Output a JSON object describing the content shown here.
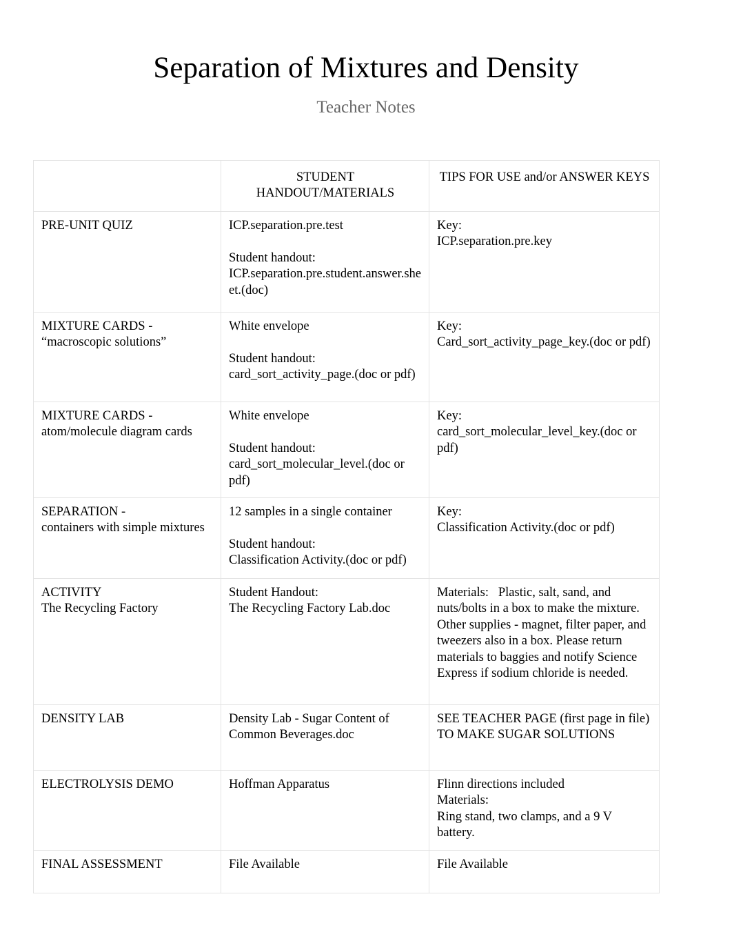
{
  "document": {
    "title": "Separation of Mixtures and Density",
    "subtitle": "Teacher Notes"
  },
  "table": {
    "headers": {
      "col1": "",
      "col2": "STUDENT HANDOUT/MATERIALS",
      "col3": "TIPS FOR USE and/or ANSWER KEYS"
    },
    "rows": [
      {
        "topic": "PRE-UNIT QUIZ",
        "handout": "ICP.separation.pre.test\n\nStudent handout:\nICP.separation.pre.student.answer.sheet.(doc)",
        "tips": "Key:\nICP.separation.pre.key"
      },
      {
        "topic": "MIXTURE CARDS -\n“macroscopic solutions”",
        "handout": "White envelope\n\nStudent handout:\ncard_sort_activity_page.(doc or pdf)",
        "tips": "Key:\nCard_sort_activity_page_key.(doc or pdf)"
      },
      {
        "topic": "MIXTURE CARDS -\natom/molecule diagram cards",
        "handout": "White envelope\n\nStudent handout:\ncard_sort_molecular_level.(doc or pdf)",
        "tips": "Key:\ncard_sort_molecular_level_key.(doc or pdf)"
      },
      {
        "topic": "SEPARATION -\ncontainers with simple mixtures",
        "handout": "12 samples in a single container\n\nStudent handout:\nClassification Activity.(doc or pdf)",
        "tips": "Key:\nClassification Activity.(doc or pdf)"
      },
      {
        "topic": "ACTIVITY\nThe Recycling Factory",
        "handout": "Student Handout:\nThe Recycling Factory Lab.doc",
        "tips": "Materials:   Plastic, salt, sand, and nuts/bolts in a box to make the mixture.   Other supplies - magnet, filter paper, and tweezers also in a box. Please return materials to baggies and notify Science Express if sodium chloride is needed."
      },
      {
        "topic": "DENSITY LAB",
        "handout": "Density Lab - Sugar Content of Common Beverages.doc",
        "tips": "SEE TEACHER PAGE (first page in file) TO MAKE SUGAR SOLUTIONS"
      },
      {
        "topic": "ELECTROLYSIS DEMO",
        "handout": "Hoffman Apparatus",
        "tips": "Flinn directions included\nMaterials:\nRing stand, two clamps, and a 9 V battery."
      },
      {
        "topic": "FINAL ASSESSMENT",
        "handout": "File Available",
        "tips": "File Available"
      }
    ]
  },
  "colors": {
    "title": "#000000",
    "subtitle": "#666666",
    "border": "#e3e3e3",
    "background": "#ffffff"
  }
}
